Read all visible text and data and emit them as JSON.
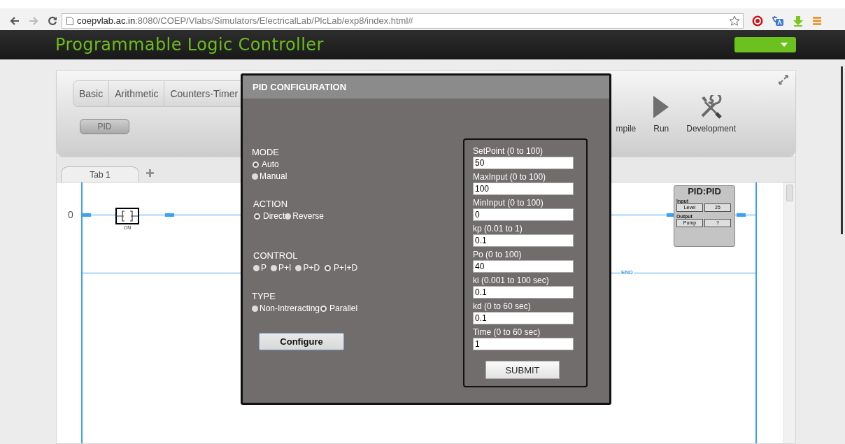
{
  "browser": {
    "url_host": "coepvlab.ac.in",
    "url_path": ":8080/COEP/Vlabs/Simulators/ElectricalLab/PlcLab/exp8/index.html#"
  },
  "header": {
    "title": "Programmable Logic Controller"
  },
  "toolbar": {
    "groups": [
      {
        "label": "Basic",
        "selected": false
      },
      {
        "label": "Arithmetic",
        "selected": false
      },
      {
        "label": "Counters-Timer",
        "selected": false
      }
    ],
    "blocks": [
      "PID"
    ],
    "actions": [
      {
        "kind": "partial",
        "label": "mpile"
      },
      {
        "kind": "run",
        "label": "Run"
      },
      {
        "kind": "development",
        "label": "Development"
      }
    ]
  },
  "program_tabs": [
    {
      "label": "Tab 1",
      "selected": true
    }
  ],
  "ladder": {
    "rungs": [
      {
        "number": "0",
        "contact": "ON"
      }
    ],
    "end_label": "END",
    "block": {
      "title": "PID:PID",
      "input_label": "Input",
      "input": [
        "Level",
        "25"
      ],
      "output_label": "Output",
      "output": [
        "Pump",
        "?"
      ]
    }
  },
  "dialog": {
    "title": "PID CONFIGURATION",
    "groups": [
      {
        "label": "MODE",
        "kind": "stacked",
        "options": [
          {
            "label": "Auto",
            "selected": true
          },
          {
            "label": "Manual",
            "selected": false
          }
        ]
      },
      {
        "label": "ACTION",
        "kind": "inline",
        "options": [
          {
            "label": "Direct",
            "selected": true
          },
          {
            "label": "Reverse",
            "selected": false
          }
        ]
      },
      {
        "label": "CONTROL",
        "kind": "spaced",
        "options": [
          {
            "label": "P",
            "selected": false
          },
          {
            "label": "P+I",
            "selected": false
          },
          {
            "label": "P+D",
            "selected": false
          },
          {
            "label": "P+I+D",
            "selected": true
          }
        ]
      },
      {
        "label": "TYPE",
        "kind": "inline",
        "options": [
          {
            "label": "Non-Intreracting",
            "selected": false
          },
          {
            "label": "Parallel",
            "selected": true
          }
        ]
      }
    ],
    "configure_button": "Configure",
    "fields": [
      {
        "label": "SetPoint (0 to 100)",
        "value": "50"
      },
      {
        "label": "MaxInput (0 to 100)",
        "value": "100"
      },
      {
        "label": "MinInput (0 to 100)",
        "value": "0"
      },
      {
        "label": "kp (0.01 to 1)",
        "value": "0.1"
      },
      {
        "label": "Po (0 to 100)",
        "value": "40"
      },
      {
        "label": "ki (0.001 to 100 sec)",
        "value": "0.1"
      },
      {
        "label": "kd (0 to 60 sec)",
        "value": "0.1"
      },
      {
        "label": "Time (0 to 60 sec)",
        "value": "1"
      }
    ],
    "submit_button": "SUBMIT"
  }
}
